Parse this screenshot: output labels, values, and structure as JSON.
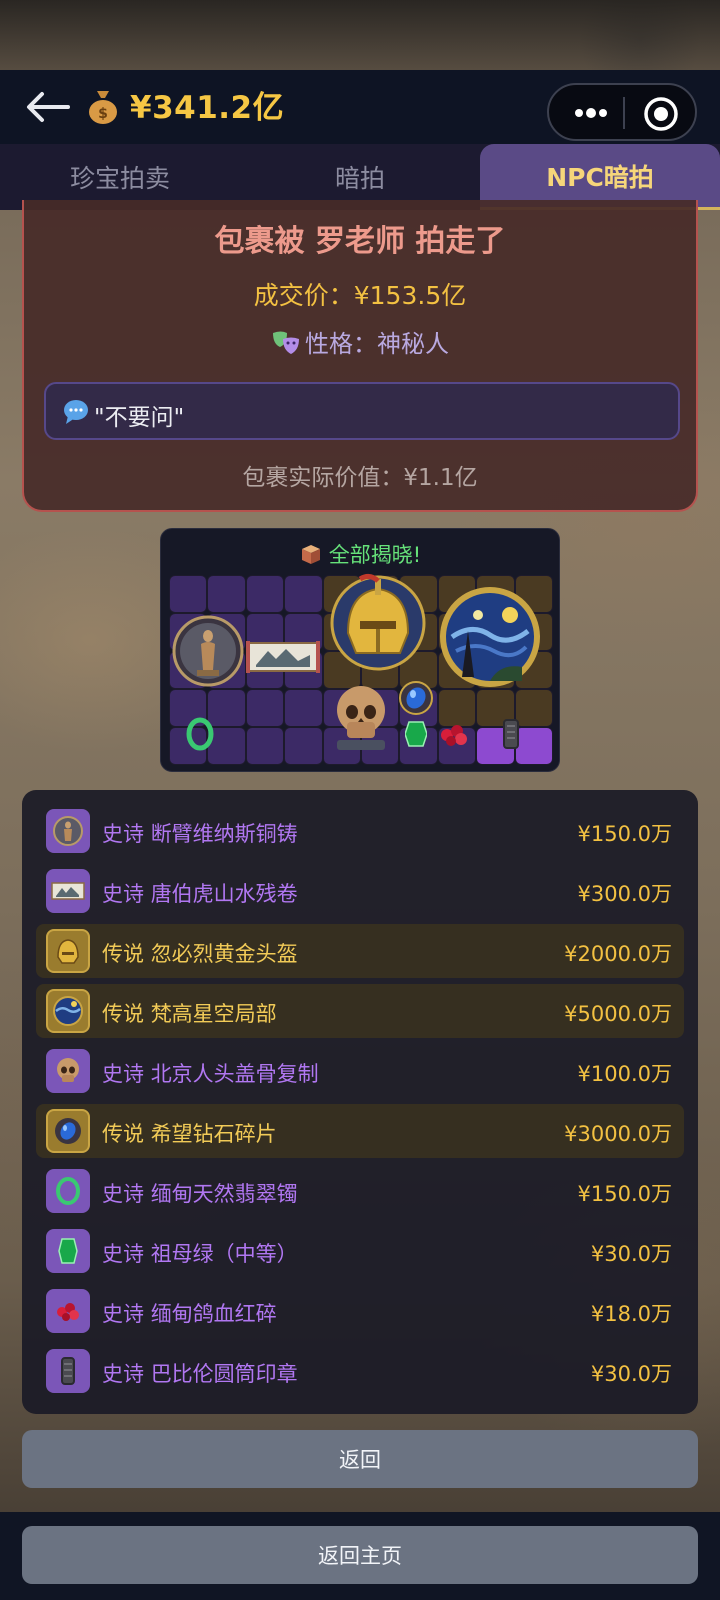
{
  "header": {
    "balance_icon": "money-bag-icon",
    "balance": "¥341.2亿"
  },
  "tabs": [
    {
      "label": "珍宝拍卖",
      "active": false
    },
    {
      "label": "暗拍",
      "active": false
    },
    {
      "label": "NPC暗拍",
      "active": true
    }
  ],
  "result": {
    "title": "包裹被 罗老师 拍走了",
    "price": "成交价：¥153.5亿",
    "personality": "性格：神秘人",
    "quote": "\"不要问\"",
    "actual_value": "包裹实际价值：¥1.1亿"
  },
  "reveal": {
    "title": "全部揭晓!"
  },
  "items": [
    {
      "rarity": "史诗",
      "name": "断臂维纳斯铜铸",
      "price": "¥150.0万",
      "tier": "epic",
      "icon": "statue-icon"
    },
    {
      "rarity": "史诗",
      "name": "唐伯虎山水残卷",
      "price": "¥300.0万",
      "tier": "epic",
      "icon": "scroll-painting-icon"
    },
    {
      "rarity": "传说",
      "name": "忽必烈黄金头盔",
      "price": "¥2000.0万",
      "tier": "legendary",
      "icon": "golden-helmet-icon"
    },
    {
      "rarity": "传说",
      "name": "梵高星空局部",
      "price": "¥5000.0万",
      "tier": "legendary",
      "icon": "starry-night-icon"
    },
    {
      "rarity": "史诗",
      "name": "北京人头盖骨复制",
      "price": "¥100.0万",
      "tier": "epic",
      "icon": "skull-icon"
    },
    {
      "rarity": "传说",
      "name": "希望钻石碎片",
      "price": "¥3000.0万",
      "tier": "legendary",
      "icon": "blue-diamond-icon"
    },
    {
      "rarity": "史诗",
      "name": "缅甸天然翡翠镯",
      "price": "¥150.0万",
      "tier": "epic",
      "icon": "jade-bracelet-icon"
    },
    {
      "rarity": "史诗",
      "name": "祖母绿（中等）",
      "price": "¥30.0万",
      "tier": "epic",
      "icon": "emerald-icon"
    },
    {
      "rarity": "史诗",
      "name": "缅甸鸽血红碎",
      "price": "¥18.0万",
      "tier": "epic",
      "icon": "ruby-icon"
    },
    {
      "rarity": "史诗",
      "name": "巴比伦圆筒印章",
      "price": "¥30.0万",
      "tier": "epic",
      "icon": "cylinder-seal-icon"
    }
  ],
  "buttons": {
    "back": "返回",
    "home": "返回主页"
  },
  "colors": {
    "gold": "#f3c142",
    "epic": "#b177f2",
    "legendary": "#f2cb57",
    "active_tab": "#5a4a86"
  }
}
